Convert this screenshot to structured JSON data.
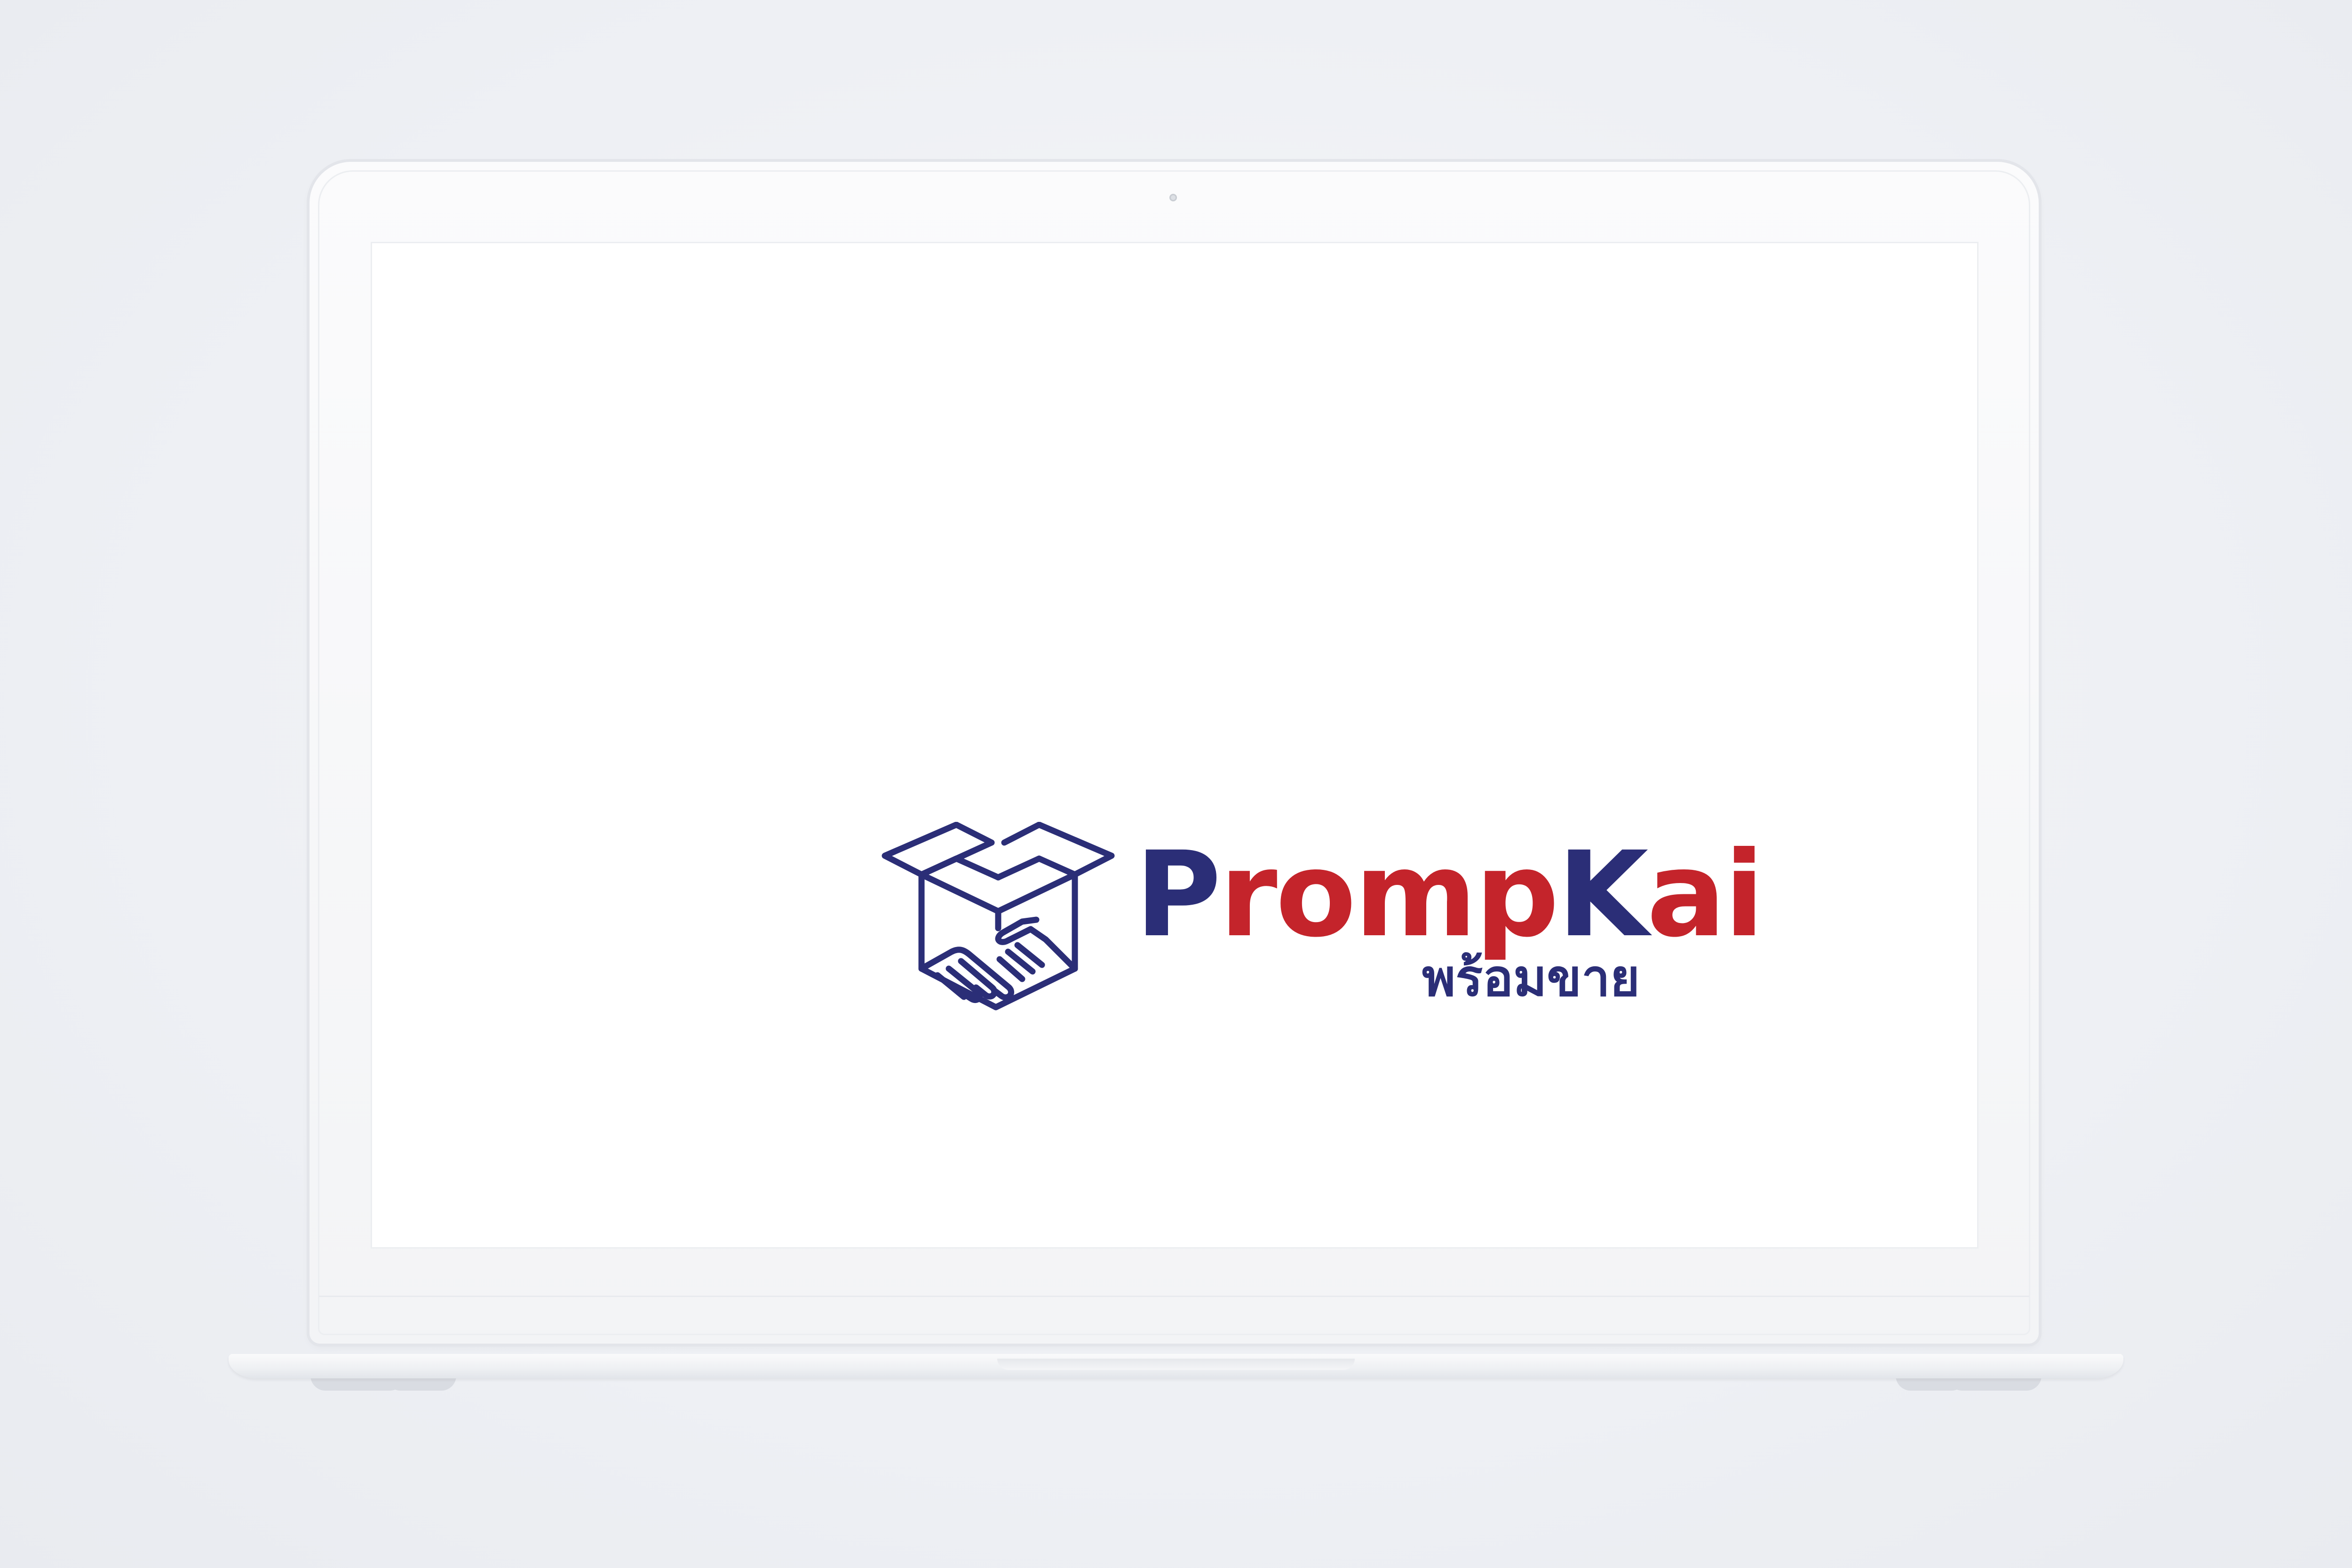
{
  "brand": {
    "name_parts": {
      "p": "P",
      "romp": "romp",
      "k": "K",
      "ai": "ai"
    },
    "thai_name": "พร้อมขาย",
    "logo_icon": "box-handshake-icon",
    "colors": {
      "navy": "#2b2e77",
      "red": "#c4242b",
      "screen_background": "#ffffff",
      "page_background": "#eef0f4"
    }
  },
  "device": {
    "type": "laptop",
    "icons": [
      "camera-icon"
    ]
  }
}
